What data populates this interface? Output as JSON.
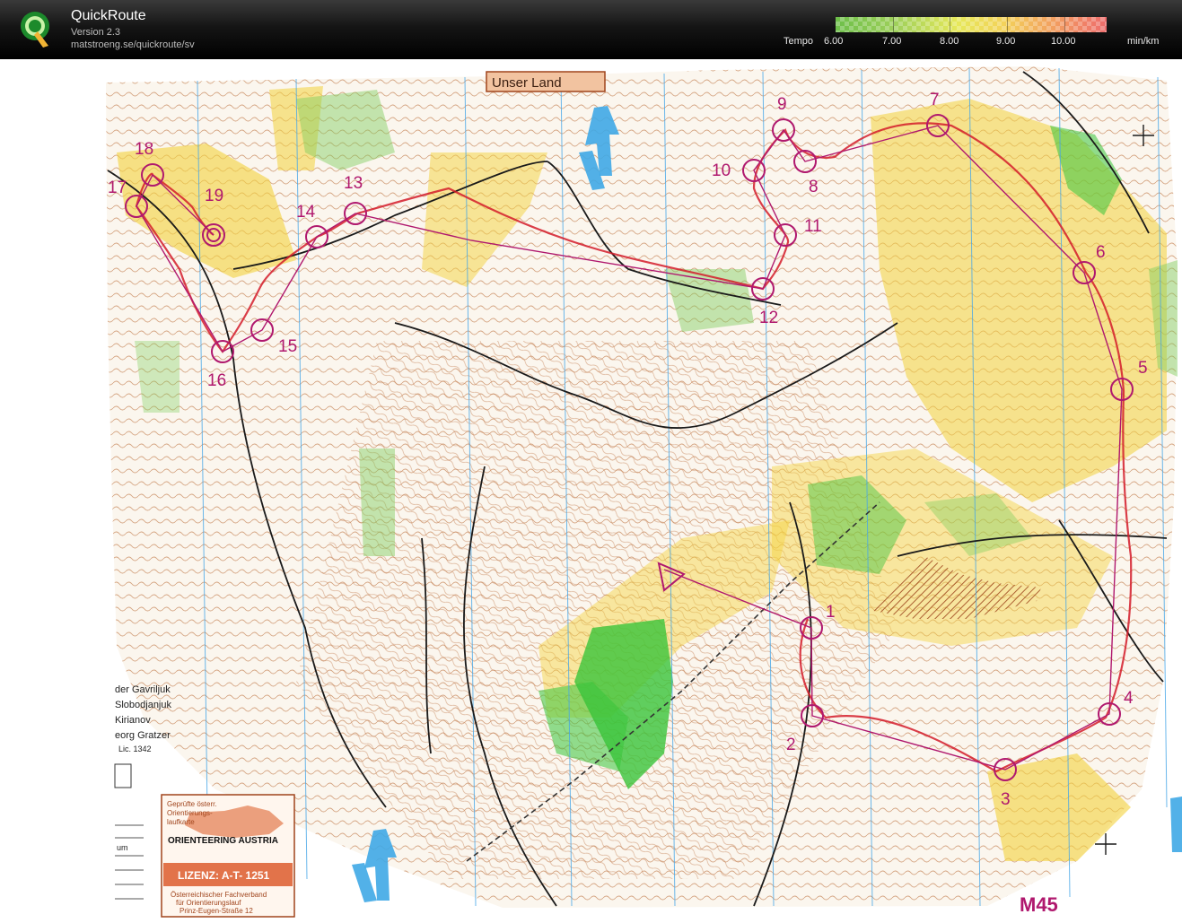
{
  "app": {
    "title": "QuickRoute",
    "version": "Version 2.3",
    "url": "matstroeng.se/quickroute/sv"
  },
  "legend": {
    "label": "Tempo",
    "values": [
      "6.00",
      "7.00",
      "8.00",
      "9.00",
      "10.00"
    ],
    "unit": "min/km"
  },
  "map": {
    "header_label": "Unser Land",
    "class_label": "M45",
    "controls": [
      "1",
      "2",
      "3",
      "4",
      "5",
      "6",
      "7",
      "8",
      "9",
      "10",
      "11",
      "12",
      "13",
      "14",
      "15",
      "16",
      "17",
      "18",
      "19"
    ],
    "credits": [
      "der Gavriljuk",
      "Slobodjanjuk",
      "Kirianov",
      "eorg Gratzer",
      "Lic. 1342"
    ],
    "stamp": {
      "line1": "Geprüfte österr.",
      "line2": "Orientierungs-",
      "line3": "laufkarte",
      "title": "ORIENTEERING AUSTRIA",
      "license": "LIZENZ: A-T- 1251",
      "footer1": "Österreichischer Fachverband",
      "footer2": "für Orientierungslauf",
      "footer3": "Prinz-Eugen-Straße 12"
    },
    "scale_label": "um",
    "colors": {
      "route": "#b0186e",
      "forest_green": "#39c43a",
      "open_yellow": "#f3d23c",
      "contour": "#c7865a"
    }
  }
}
